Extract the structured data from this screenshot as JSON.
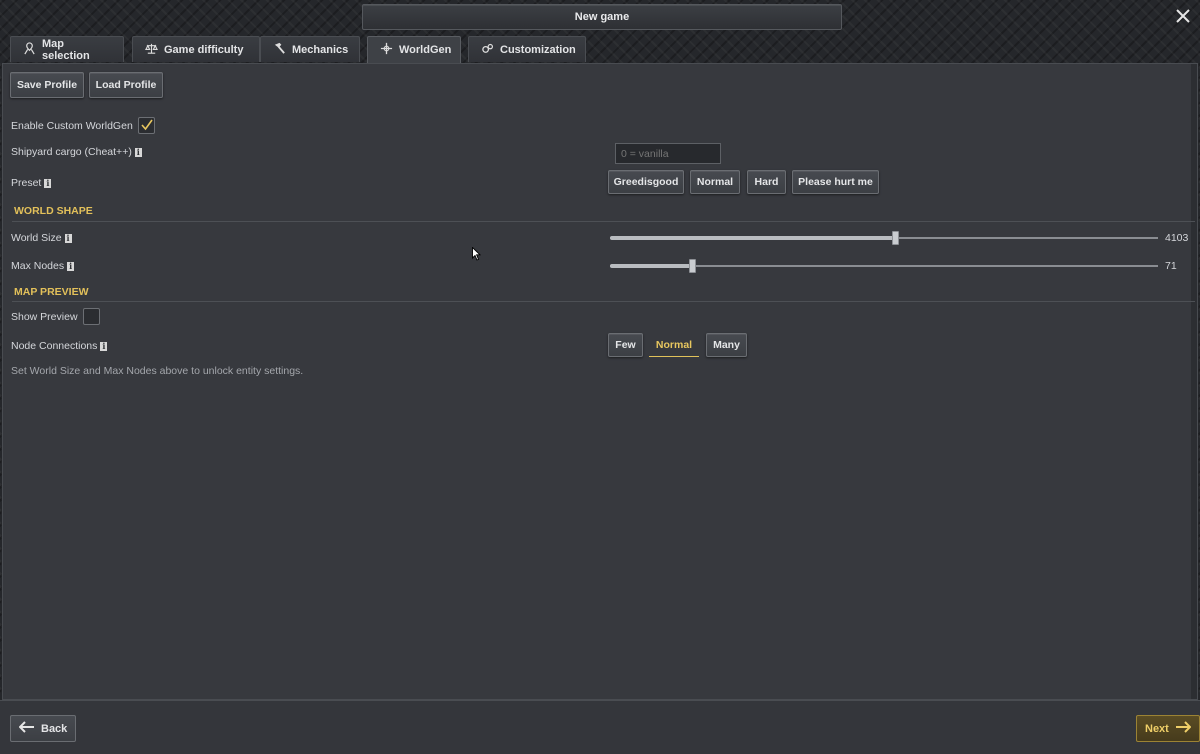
{
  "window": {
    "title": "New game"
  },
  "tabs": [
    {
      "label": "Map selection",
      "icon": "map-marker-icon"
    },
    {
      "label": "Game difficulty",
      "icon": "scales-icon"
    },
    {
      "label": "Mechanics",
      "icon": "hammer-icon"
    },
    {
      "label": "WorldGen",
      "icon": "plus-node-icon",
      "active": true
    },
    {
      "label": "Customization",
      "icon": "gears-icon"
    }
  ],
  "profile": {
    "save_label": "Save Profile",
    "load_label": "Load Profile"
  },
  "settings": {
    "enable_custom_label": "Enable Custom WorldGen",
    "enable_custom_checked": true,
    "shipyard_label": "Shipyard cargo (Cheat++)",
    "shipyard_placeholder": "0 = vanilla",
    "preset_label": "Preset",
    "preset_options": [
      "Greedisgood",
      "Normal",
      "Hard",
      "Please hurt me"
    ]
  },
  "world_shape": {
    "heading": "WORLD SHAPE",
    "world_size_label": "World Size",
    "world_size_value": "4103",
    "world_size_fraction": 0.52,
    "max_nodes_label": "Max Nodes",
    "max_nodes_value": "71",
    "max_nodes_fraction": 0.15
  },
  "map_preview": {
    "heading": "MAP PREVIEW",
    "show_preview_label": "Show Preview",
    "show_preview_checked": false,
    "node_connections_label": "Node Connections",
    "node_connection_options": [
      "Few",
      "Normal",
      "Many"
    ],
    "node_connection_selected": "Normal",
    "hint": "Set World Size and Max Nodes above to unlock entity settings."
  },
  "footer": {
    "back_label": "Back",
    "next_label": "Next"
  },
  "info_glyph": "i",
  "colors": {
    "accent": "#e2c05a",
    "panel": "#37393e",
    "background": "#25272b"
  }
}
